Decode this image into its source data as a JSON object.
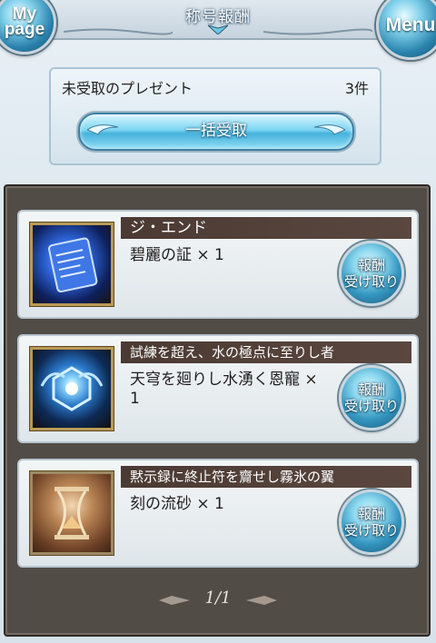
{
  "header": {
    "title": "称号報酬",
    "mypage_line1": "My",
    "mypage_line2": "page",
    "menu_label": "Menu"
  },
  "presents": {
    "label": "未受取のプレゼント",
    "count": "3件",
    "bulk_receive_label": "一括受取"
  },
  "rewards": [
    {
      "title": "ジ・エンド",
      "reward": "碧麗の証 × 1",
      "button_line1": "報酬",
      "button_line2": "受け取り",
      "icon": "scroll-icon"
    },
    {
      "title": "試練を超え、水の極点に至りし者",
      "reward": "天穹を廻りし水湧く恩寵 × 1",
      "button_line1": "報酬",
      "button_line2": "受け取り",
      "icon": "water-crest-icon"
    },
    {
      "title": "黙示録に終止符を齎せし霧氷の翼",
      "reward": "刻の流砂 × 1",
      "button_line1": "報酬",
      "button_line2": "受け取り",
      "icon": "hourglass-icon"
    }
  ],
  "pagination": {
    "current": "1/1"
  },
  "colors": {
    "accent": "#46b2db",
    "title_bar": "#4b3a33",
    "panel_bg": "#524c47"
  }
}
